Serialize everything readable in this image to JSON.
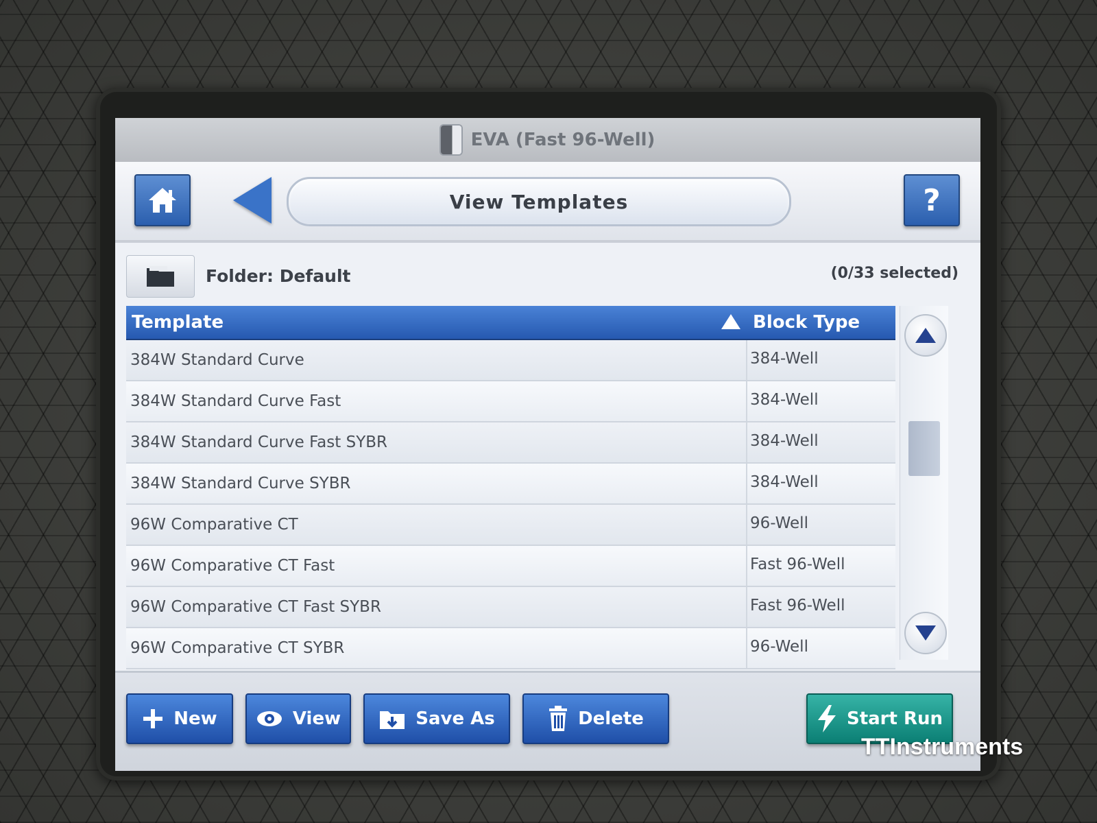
{
  "window": {
    "title": "EVA (Fast 96-Well)"
  },
  "nav": {
    "page_title": "View Templates",
    "help_label": "?"
  },
  "folder": {
    "label": "Folder:  Default",
    "selected_count": "(0/33 selected)"
  },
  "table": {
    "columns": {
      "template": "Template",
      "block_type": "Block Type"
    },
    "rows": [
      {
        "template": "384W Standard Curve",
        "block_type": "384-Well"
      },
      {
        "template": "384W Standard Curve Fast",
        "block_type": "384-Well"
      },
      {
        "template": "384W Standard Curve Fast SYBR",
        "block_type": "384-Well"
      },
      {
        "template": "384W Standard Curve SYBR",
        "block_type": "384-Well"
      },
      {
        "template": "96W Comparative CT",
        "block_type": "96-Well"
      },
      {
        "template": "96W Comparative CT Fast",
        "block_type": "Fast 96-Well"
      },
      {
        "template": "96W Comparative CT Fast SYBR",
        "block_type": "Fast 96-Well"
      },
      {
        "template": "96W Comparative CT SYBR",
        "block_type": "96-Well"
      }
    ]
  },
  "toolbar": {
    "new_label": "New",
    "view_label": "View",
    "save_as_label": "Save As",
    "delete_label": "Delete",
    "start_run_label": "Start Run"
  },
  "watermark": "TTInstruments",
  "colors": {
    "accent_blue": "#2b5fae",
    "header_blue": "#2659b0",
    "start_teal": "#0b7f74",
    "scroll_arrow": "#25428f"
  }
}
